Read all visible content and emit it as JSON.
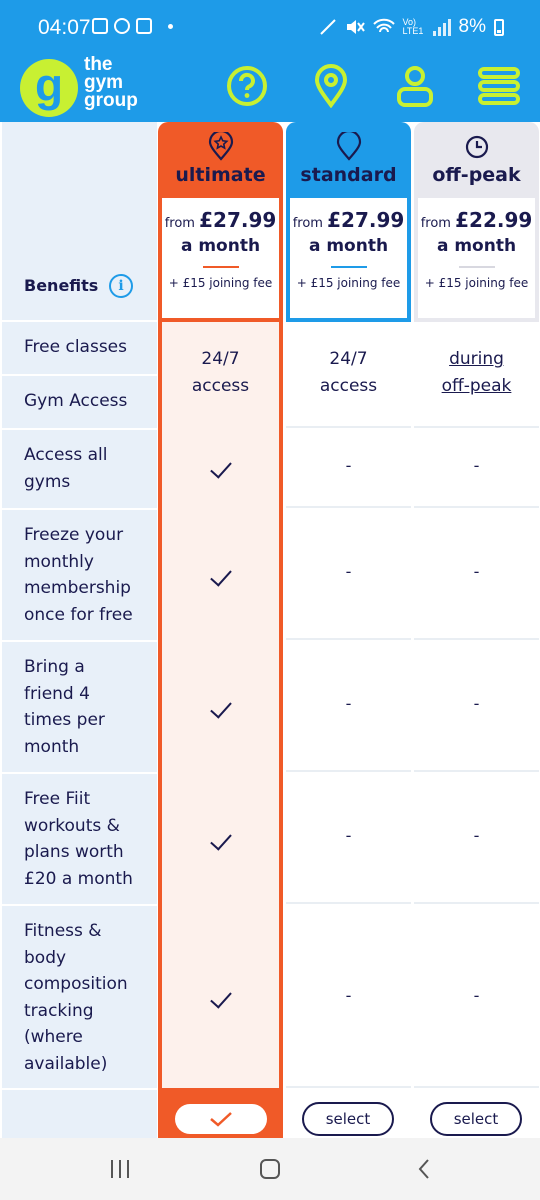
{
  "status_bar": {
    "time": "04:07",
    "battery": "8%",
    "network_label": "Vo) LTE1"
  },
  "header": {
    "logo_letter": "g",
    "logo_lines": [
      "the",
      "gym",
      "group"
    ],
    "icons": [
      "help-icon",
      "location-icon",
      "account-icon",
      "menu-icon"
    ]
  },
  "table": {
    "benefits_label": "Benefits",
    "info_icon_glyph": "i",
    "benefit_rows": [
      [
        "Free classes"
      ],
      [
        "Gym Access"
      ],
      [
        "Access all",
        "gyms"
      ],
      [
        "Freeze your",
        "monthly",
        "membership",
        "once for free"
      ],
      [
        "Bring a",
        "friend 4",
        "times per",
        "month"
      ],
      [
        "Free Fiit",
        "workouts &",
        "plans worth",
        "£20 a month"
      ],
      [
        "Fitness &",
        "body",
        "composition",
        "tracking",
        "(where",
        "available)"
      ]
    ],
    "plans": [
      {
        "name": "ultimate",
        "price_from": "from",
        "price": "£27.99",
        "period": "a month",
        "joining_fee": "+ £15 joining fee",
        "access_lines": [
          "24/7",
          "access"
        ],
        "values": [
          "tick",
          "tick",
          "tick",
          "tick",
          "tick"
        ],
        "selected": true,
        "accent": "#f05a28"
      },
      {
        "name": "standard",
        "price_from": "from",
        "price": "£27.99",
        "period": "a month",
        "joining_fee": "+ £15 joining fee",
        "access_lines": [
          "24/7",
          "access"
        ],
        "values": [
          "-",
          "-",
          "-",
          "-",
          "-"
        ],
        "select_label": "select",
        "accent": "#1e9be8"
      },
      {
        "name": "off-peak",
        "price_from": "from",
        "price": "£22.99",
        "period": "a month",
        "joining_fee": "+ £15 joining fee",
        "access_lines": [
          "during",
          "off-peak"
        ],
        "values": [
          "-",
          "-",
          "-",
          "-",
          "-"
        ],
        "select_label": "select",
        "accent": "#e8e8ee"
      }
    ]
  },
  "colors": {
    "brand_blue": "#1e9be8",
    "brand_lime": "#c8f032",
    "navy": "#1a1a4e",
    "ultimate_orange": "#f05a28",
    "ultimate_tint": "#fdf1ec"
  }
}
